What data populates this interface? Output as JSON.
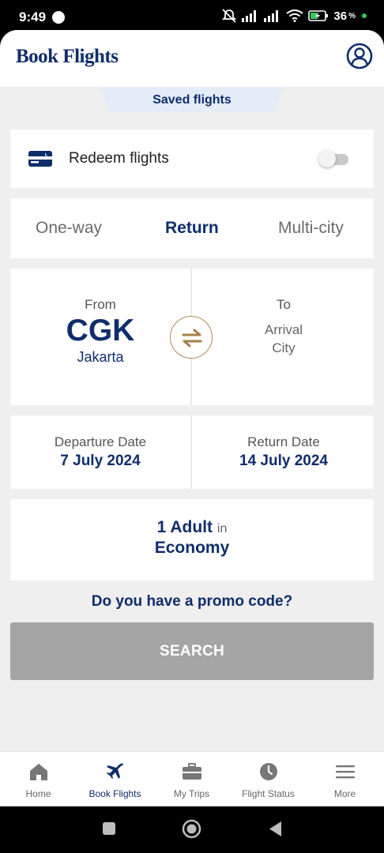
{
  "status_bar": {
    "time": "9:49",
    "battery_percent": "36"
  },
  "header": {
    "title": "Book Flights",
    "profile_icon": "user-circle-icon"
  },
  "saved_tab": {
    "label": "Saved flights"
  },
  "redeem": {
    "label": "Redeem flights",
    "toggle_on": false,
    "icon": "card-icon"
  },
  "trip_types": {
    "options": [
      "One-way",
      "Return",
      "Multi-city"
    ],
    "selected": "Return"
  },
  "route": {
    "from_label": "From",
    "from_code": "CGK",
    "from_city": "Jakarta",
    "to_label": "To",
    "to_placeholder_line1": "Arrival",
    "to_placeholder_line2": "City",
    "swap_icon": "swap-arrows-icon"
  },
  "dates": {
    "departure_label": "Departure Date",
    "departure_value": "7 July 2024",
    "return_label": "Return Date",
    "return_value": "14 July 2024"
  },
  "passengers": {
    "count_text": "1 Adult",
    "in_text": "in",
    "cabin": "Economy"
  },
  "promo": {
    "label": "Do you have a promo code?"
  },
  "search": {
    "label": "SEARCH"
  },
  "bottom_nav": {
    "items": [
      {
        "label": "Home",
        "icon": "home-icon"
      },
      {
        "label": "Book Flights",
        "icon": "plane-icon"
      },
      {
        "label": "My Trips",
        "icon": "briefcase-icon"
      },
      {
        "label": "Flight Status",
        "icon": "clock-icon"
      },
      {
        "label": "More",
        "icon": "menu-icon"
      }
    ],
    "active": "Book Flights"
  },
  "colors": {
    "brand_navy": "#0f2d6b",
    "accent_gold": "#b08b56",
    "disabled_button": "#a5a5a5"
  }
}
